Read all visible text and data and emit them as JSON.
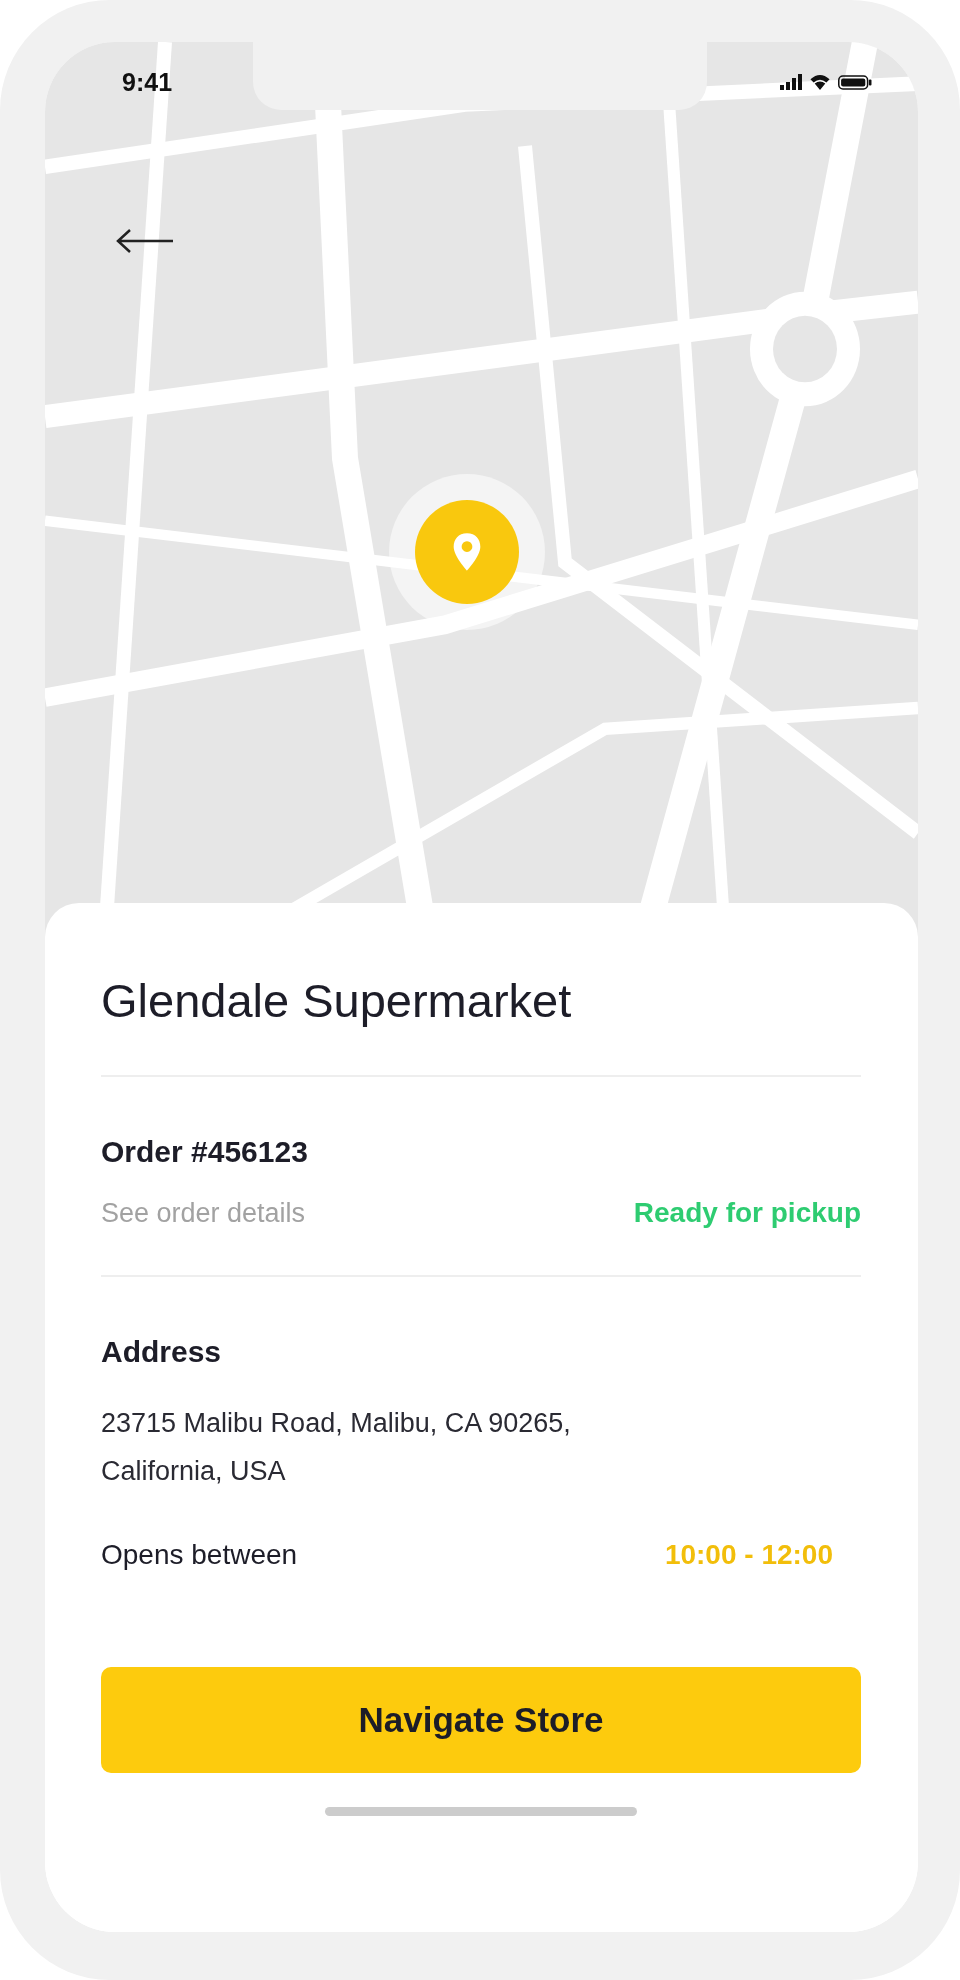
{
  "status_bar": {
    "time": "9:41"
  },
  "store": {
    "name": "Glendale Supermarket"
  },
  "order": {
    "number": "Order #456123",
    "details_link": "See order details",
    "status": "Ready for pickup"
  },
  "address": {
    "label": "Address",
    "text": "23715 Malibu Road, Malibu, CA 90265, California, USA",
    "hours_label": "Opens between",
    "hours": "10:00 - 12:00"
  },
  "button": {
    "label": "Navigate Store"
  }
}
